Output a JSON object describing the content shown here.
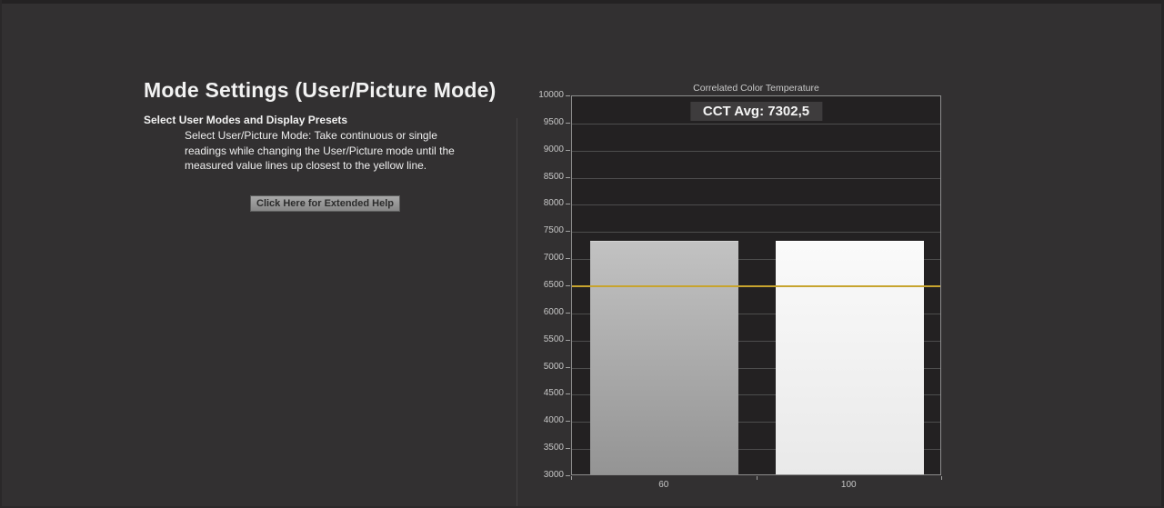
{
  "left_panel": {
    "title": "Mode Settings (User/Picture Mode)",
    "subtitle": "Select User Modes and Display Presets",
    "body": "Select User/Picture Mode: Take continuous or single readings while changing the User/Picture mode until the measured value lines up closest to the yellow line.",
    "help_button_label": "Click Here for Extended Help"
  },
  "chart_data": {
    "type": "bar",
    "title": "Correlated Color Temperature",
    "avg_label": "CCT Avg: 7302,5",
    "categories": [
      "60",
      "100"
    ],
    "values": [
      7302.5,
      7302.5
    ],
    "ylim": [
      3000,
      10000
    ],
    "ytick_step": 500,
    "target_line": {
      "value": 6500,
      "color": "#c7a42e"
    },
    "bar_colors": [
      "#a8a8a8",
      "#f2f2f2"
    ],
    "legend_position": "none",
    "grid": true
  }
}
